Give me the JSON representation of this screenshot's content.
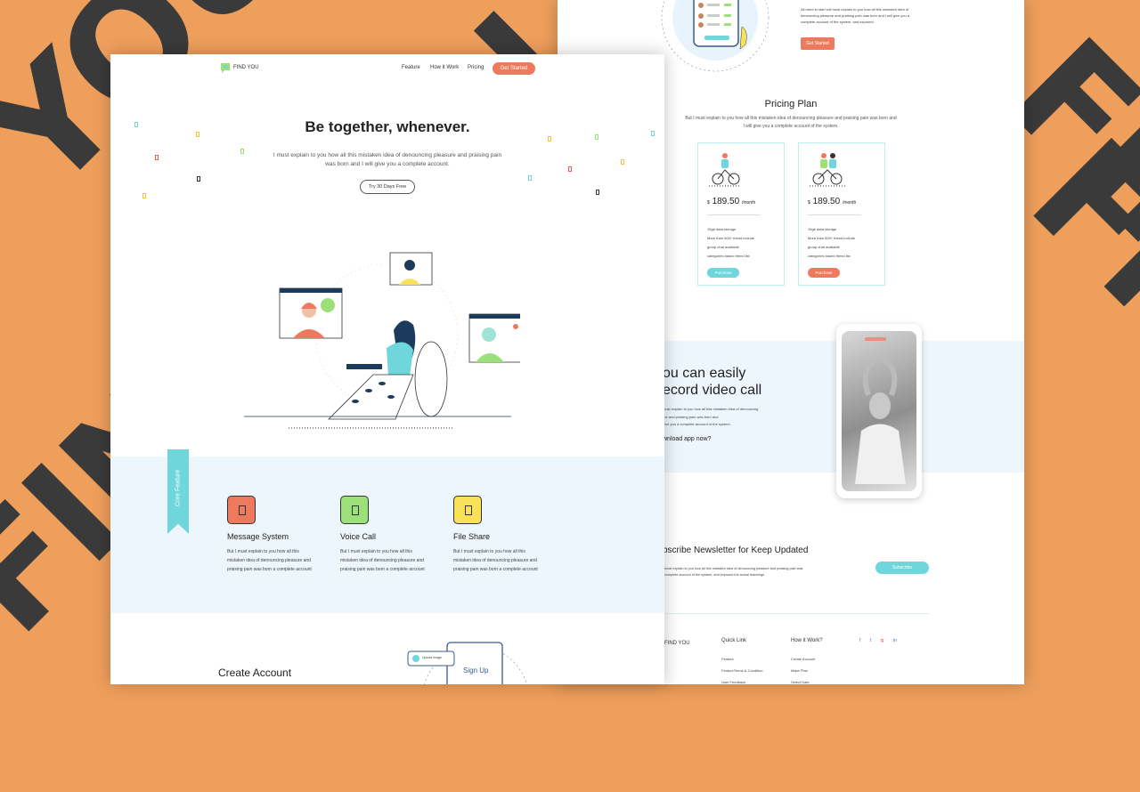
{
  "brand": "FIND YOU",
  "background_words": {
    "left_top": "YOU",
    "left_mid": "FIND YOU",
    "right_mid": "FIND",
    "right_bottom": "FIND YOU"
  },
  "nav": {
    "items": [
      "Feature",
      "How it Work",
      "Pricing"
    ],
    "cta": "Get Started"
  },
  "hero": {
    "title": "Be together, whenever.",
    "subtitle_line1": "I must explain to you how all this mistaken idea of denouncing pleasure and praising pain",
    "subtitle_line2": "was born and I will give you a complete account.",
    "button": "Try 30 Days Free"
  },
  "core": {
    "ribbon": "Core Feature",
    "features": [
      {
        "title": "Message System",
        "text1": "But I must explain to you how all this",
        "text2": "mistaken idea of denouncing pleasure and",
        "text3": "praising pain was born a complete account",
        "color": "#ee7a5e"
      },
      {
        "title": "Voice Call",
        "text1": "But I must explain to you how all this",
        "text2": "mistaken idea of denouncing pleasure and",
        "text3": "praising pain was born a complete account",
        "color": "#9ce07a"
      },
      {
        "title": "File Share",
        "text1": "But I must explain to you how all this",
        "text2": "mistaken idea of denouncing pleasure and",
        "text3": "praising pain was born a complete account",
        "color": "#f9e25a"
      }
    ]
  },
  "account": {
    "title": "Create Account",
    "signup": "Sign Up",
    "upload": "Upload Image"
  },
  "right_top": {
    "text1": "All need to start will must explain to you how all this mistaken idea of",
    "text2": "denouncing pleasure and praising pain was born and I will give you a",
    "text3": "complete account of the system, and expound.",
    "button": "Get Started"
  },
  "pricing": {
    "title": "Pricing Plan",
    "sub1": "But I must explain to you how all this mistaken idea of denouncing pleasure and praising pain was born and",
    "sub2": "I will give you a complete account of the system.",
    "plans": [
      {
        "currency": "$",
        "price": "189.50",
        "period": "/month",
        "features": [
          "15gb data storage",
          "More than 500+ friend include",
          "group chat available",
          "categories based friend list"
        ],
        "button": "Purchase",
        "accent": "#6fd6dc"
      },
      {
        "currency": "$",
        "price": "189.50",
        "period": "/month",
        "features": [
          "15gb data storage",
          "More than 500+ friend include",
          "group chat available",
          "categories based friend list"
        ],
        "button": "Purchase",
        "accent": "#ee7a5e"
      }
    ]
  },
  "video": {
    "title1": "ou can easily",
    "title2": "ecord video call",
    "text1": "must explain to you how all this mistaken idea of denouncing",
    "text2": "ure and praising pain was born and",
    "text3": "give you a complete account of the system.",
    "download": "wnload app now?"
  },
  "newsletter": {
    "title": "bscribe Newsletter for Keep Updated",
    "text1": "t must explain to you how all this mistaken idea of denouncing pleasure and praising pain was",
    "text2": "l complete account of the system, and expound the actual teachings",
    "button": "Subscribe"
  },
  "footer": {
    "brand": "FIND YOU",
    "quick_title": "Quick Link",
    "quick": [
      "Feature",
      "FeatureTerms & Condition",
      "User Feedback"
    ],
    "how_title": "How it Work?",
    "how": [
      "Create Account",
      "Make Plan",
      "Select Date"
    ],
    "social": [
      "f",
      "t",
      "ig",
      "in"
    ]
  },
  "colors": {
    "background": "#ef9f5c",
    "coral": "#ee7a5e",
    "cyan": "#6fd6dc",
    "light_blue": "#eef6fd"
  }
}
